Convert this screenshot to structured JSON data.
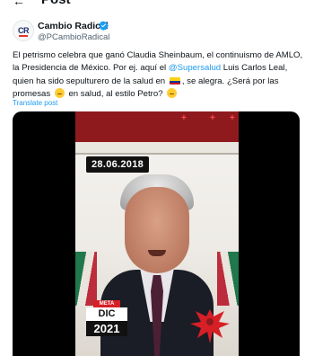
{
  "header": {
    "back_icon": "arrow-left-icon",
    "title": "Post"
  },
  "author": {
    "avatar_text": "CR",
    "name": "Cambio Radical",
    "handle": "@PCambioRadical",
    "verified_color": "#1d9bf0"
  },
  "tweet": {
    "text_part1": "El petrismo celebra que ganó Claudia Sheinbaum, el continuismo de AMLO, la Presidencia de México. Por ej. aquí el ",
    "mention": "@Supersalud",
    "text_part2": " Luis Carlos Leal, quien ha sido sepulturero de la salud en ",
    "text_part3": ", se alegra. ¿Será por las promesas ",
    "text_part4": " en salud, al estilo Petro? ",
    "translate_link": "Translate post"
  },
  "media": {
    "date_overlay": "28.06.2018",
    "meta_label": "META",
    "meta_month": "DIC",
    "meta_year": "2021"
  },
  "colors": {
    "accent": "#1d9bf0",
    "text": "#0f1419",
    "muted": "#536471"
  }
}
